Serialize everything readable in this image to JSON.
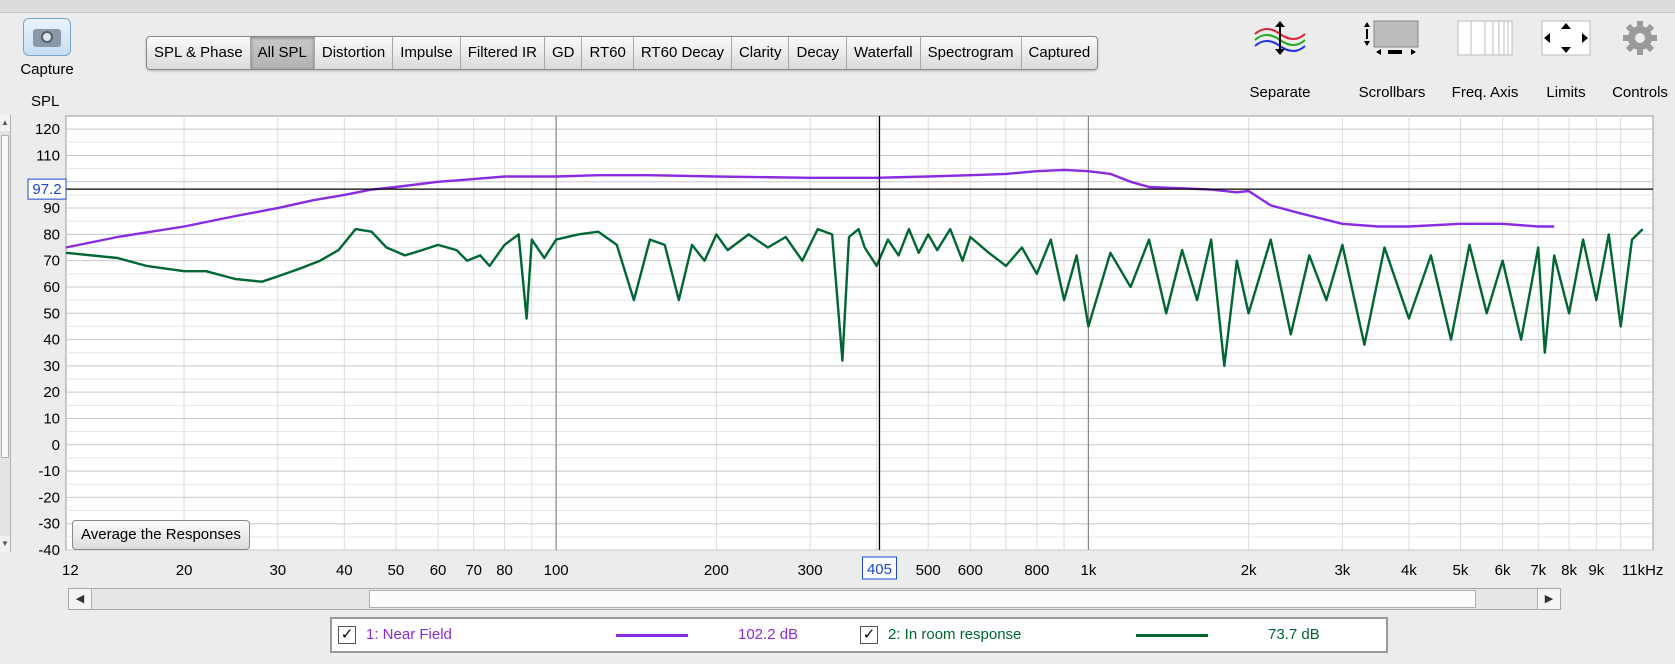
{
  "toolbar": {
    "capture_label": "Capture",
    "tabs": [
      {
        "label": "SPL & Phase",
        "active": false
      },
      {
        "label": "All SPL",
        "active": true
      },
      {
        "label": "Distortion",
        "active": false
      },
      {
        "label": "Impulse",
        "active": false
      },
      {
        "label": "Filtered IR",
        "active": false
      },
      {
        "label": "GD",
        "active": false
      },
      {
        "label": "RT60",
        "active": false
      },
      {
        "label": "RT60 Decay",
        "active": false
      },
      {
        "label": "Clarity",
        "active": false
      },
      {
        "label": "Decay",
        "active": false
      },
      {
        "label": "Waterfall",
        "active": false
      },
      {
        "label": "Spectrogram",
        "active": false
      },
      {
        "label": "Captured",
        "active": false
      }
    ],
    "tools": [
      {
        "label": "Separate",
        "icon": "separate-icon"
      },
      {
        "label": "Scrollbars",
        "icon": "scrollbars-icon"
      },
      {
        "label": "Freq. Axis",
        "icon": "freq-axis-icon"
      },
      {
        "label": "Limits",
        "icon": "limits-icon"
      },
      {
        "label": "Controls",
        "icon": "gear-icon"
      }
    ]
  },
  "average_button": "Average the Responses",
  "chart_data": {
    "type": "line",
    "ylabel": "SPL",
    "x_scale": "log",
    "xlim": [
      12,
      11500
    ],
    "ylim": [
      -40,
      125
    ],
    "x_ticks": [
      {
        "value": 12,
        "label": "12"
      },
      {
        "value": 20,
        "label": "20"
      },
      {
        "value": 30,
        "label": "30"
      },
      {
        "value": 40,
        "label": "40"
      },
      {
        "value": 50,
        "label": "50"
      },
      {
        "value": 60,
        "label": "60"
      },
      {
        "value": 70,
        "label": "70"
      },
      {
        "value": 80,
        "label": "80"
      },
      {
        "value": 100,
        "label": "100"
      },
      {
        "value": 200,
        "label": "200"
      },
      {
        "value": 300,
        "label": "300"
      },
      {
        "value": 500,
        "label": "500"
      },
      {
        "value": 600,
        "label": "600"
      },
      {
        "value": 800,
        "label": "800"
      },
      {
        "value": 1000,
        "label": "1k"
      },
      {
        "value": 2000,
        "label": "2k"
      },
      {
        "value": 3000,
        "label": "3k"
      },
      {
        "value": 4000,
        "label": "4k"
      },
      {
        "value": 5000,
        "label": "5k"
      },
      {
        "value": 6000,
        "label": "6k"
      },
      {
        "value": 7000,
        "label": "7k"
      },
      {
        "value": 8000,
        "label": "8k"
      },
      {
        "value": 9000,
        "label": "9k"
      },
      {
        "value": 11000,
        "label": "11kHz"
      }
    ],
    "y_ticks": [
      120,
      110,
      90,
      80,
      70,
      60,
      50,
      40,
      30,
      20,
      10,
      0,
      -10,
      -20,
      -30,
      -40
    ],
    "cursor": {
      "x": 405,
      "x_label": "405",
      "y": 97.2,
      "y_label": "97.2"
    },
    "grid": true,
    "series": [
      {
        "name": "1: Near Field",
        "color": "#8a2be2",
        "x": [
          12,
          15,
          20,
          25,
          30,
          35,
          40,
          45,
          50,
          60,
          70,
          80,
          90,
          100,
          120,
          150,
          200,
          300,
          400,
          500,
          600,
          700,
          800,
          900,
          1000,
          1100,
          1200,
          1300,
          1500,
          1700,
          1900,
          2000,
          2200,
          2500,
          3000,
          3500,
          4000,
          5000,
          6000,
          7000,
          7500
        ],
        "y": [
          75,
          79,
          83,
          87,
          90,
          93,
          95,
          97,
          98,
          100,
          101,
          102,
          102,
          102,
          102.5,
          102.5,
          102,
          101.5,
          101.5,
          102,
          102.5,
          103,
          104,
          104.5,
          104,
          103,
          100,
          98,
          97.5,
          97,
          96,
          96.5,
          91,
          88,
          84,
          83,
          83,
          84,
          84,
          83,
          83
        ]
      },
      {
        "name": "2: In room response",
        "color": "#006633",
        "x": [
          12,
          15,
          17,
          20,
          22,
          25,
          28,
          30,
          33,
          36,
          39,
          42,
          45,
          48,
          52,
          56,
          60,
          65,
          68,
          72,
          75,
          80,
          85,
          88,
          90,
          95,
          100,
          110,
          120,
          130,
          140,
          150,
          160,
          170,
          180,
          190,
          200,
          210,
          230,
          250,
          270,
          290,
          310,
          330,
          345,
          355,
          370,
          380,
          400,
          420,
          440,
          460,
          480,
          500,
          520,
          550,
          580,
          600,
          650,
          700,
          750,
          800,
          850,
          900,
          950,
          1000,
          1100,
          1200,
          1300,
          1400,
          1500,
          1600,
          1700,
          1800,
          1900,
          2000,
          2200,
          2400,
          2600,
          2800,
          3000,
          3300,
          3600,
          4000,
          4400,
          4800,
          5200,
          5600,
          6000,
          6500,
          7000,
          7200,
          7500,
          8000,
          8500,
          9000,
          9500,
          10000,
          10500,
          11000
        ],
        "y": [
          73,
          71,
          68,
          66,
          66,
          63,
          62,
          64,
          67,
          70,
          74,
          82,
          81,
          75,
          72,
          74,
          76,
          74,
          70,
          72,
          68,
          76,
          80,
          48,
          78,
          71,
          78,
          80,
          81,
          76,
          55,
          78,
          76,
          55,
          76,
          70,
          80,
          74,
          80,
          75,
          79,
          70,
          82,
          80,
          32,
          79,
          82,
          75,
          68,
          78,
          72,
          82,
          73,
          80,
          74,
          82,
          70,
          79,
          73,
          68,
          75,
          65,
          78,
          55,
          72,
          45,
          73,
          60,
          78,
          50,
          74,
          55,
          78,
          30,
          70,
          50,
          78,
          42,
          72,
          55,
          76,
          38,
          75,
          48,
          72,
          40,
          76,
          50,
          70,
          40,
          75,
          35,
          72,
          50,
          78,
          55,
          80,
          45,
          78,
          82
        ]
      }
    ]
  },
  "legend": [
    {
      "label": "1: Near Field",
      "value": "102.2 dB",
      "checked": true,
      "color": "#8a2be2"
    },
    {
      "label": "2: In room response",
      "value": "73.7 dB",
      "checked": true,
      "color": "#006633"
    }
  ]
}
